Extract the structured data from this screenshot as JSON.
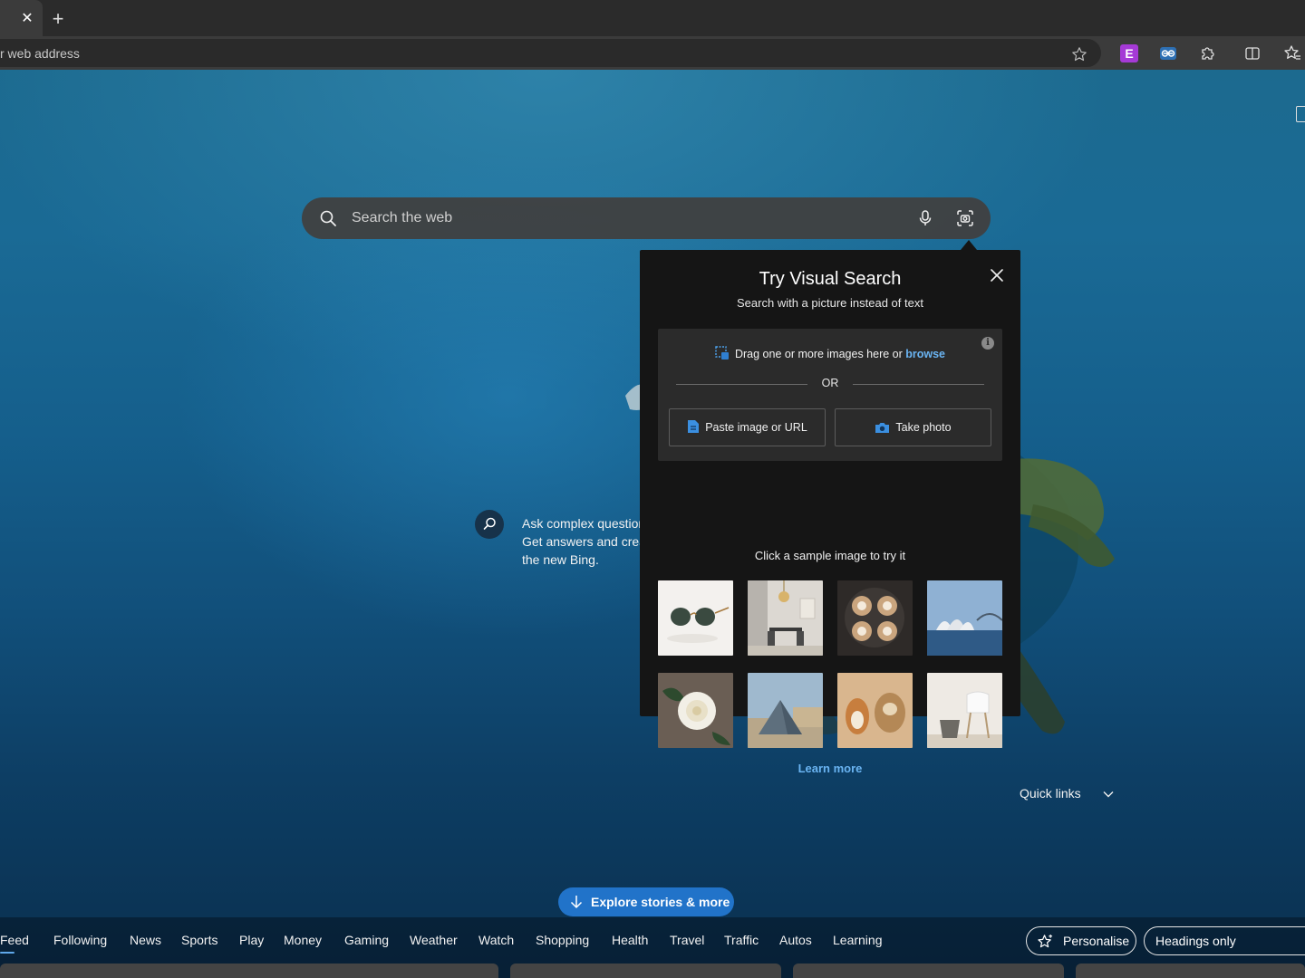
{
  "browser": {
    "tab": {
      "close_glyph": "✕"
    },
    "new_tab_glyph": "+",
    "address_bar": {
      "text": "r web address"
    },
    "extensions": {
      "e_label": "E"
    },
    "icons": [
      "close-icon",
      "plus-icon",
      "star-icon",
      "extension-e-icon",
      "link-icon",
      "puzzle-icon",
      "split-screen-icon",
      "favorites-icon"
    ]
  },
  "search": {
    "placeholder": "Search the web",
    "icons": [
      "search-icon",
      "microphone-icon",
      "visual-search-icon"
    ]
  },
  "visual_search": {
    "title": "Try Visual Search",
    "subtitle": "Search with a picture instead of text",
    "drag_text": "Drag one or more images here or ",
    "browse_link": "browse",
    "or_label": "OR",
    "paste_button": "Paste image or URL",
    "photo_button": "Take photo",
    "info_glyph": "i",
    "sample_label": "Click a sample image to try it",
    "samples": [
      "sunglasses",
      "dining-room",
      "latte-art",
      "sydney-opera-house",
      "white-rose",
      "louvre-pyramid",
      "dogs",
      "chair"
    ],
    "learn_more": "Learn more",
    "accent_color": "#6ab4f2"
  },
  "chat": {
    "lines": [
      "Ask complex questions",
      "Get answers and create",
      "the new Bing."
    ]
  },
  "quick_links": {
    "label": "Quick links"
  },
  "explore": {
    "label": "Explore stories & more",
    "color": "#2173c9"
  },
  "nav": {
    "items": [
      "Feed",
      "Following",
      "News",
      "Sports",
      "Play",
      "Money",
      "Gaming",
      "Weather",
      "Watch",
      "Shopping",
      "Health",
      "Travel",
      "Traffic",
      "Autos",
      "Learning"
    ],
    "personalise": "Personalise",
    "headings": "Headings only"
  }
}
